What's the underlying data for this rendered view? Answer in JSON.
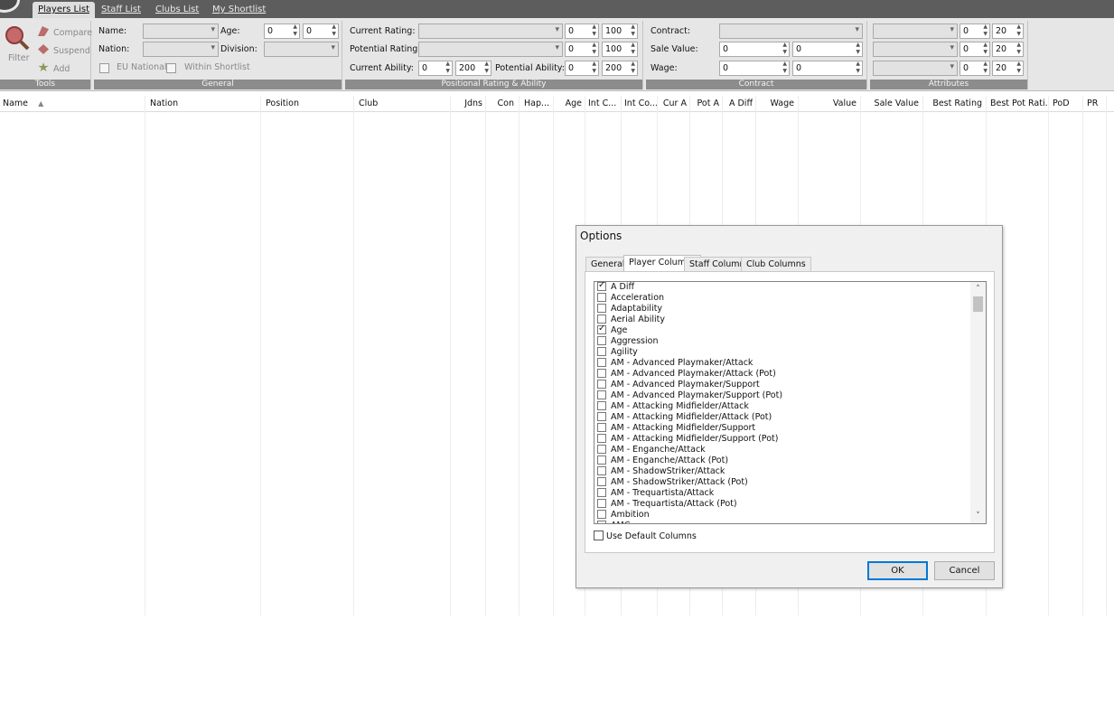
{
  "main_tabs": [
    {
      "label": "Players List"
    },
    {
      "label": "Staff List"
    },
    {
      "label": "Clubs List"
    },
    {
      "label": "My Shortlist"
    }
  ],
  "tools": {
    "filter": "Filter",
    "compare": "Compare",
    "suspend": "Suspend",
    "add": "Add",
    "title": "Tools"
  },
  "general": {
    "name_label": "Name:",
    "nation_label": "Nation:",
    "age_label": "Age:",
    "division_label": "Division:",
    "eu_national": "EU National",
    "within_shortlist": "Within Shortlist",
    "age_min": "0",
    "age_max": "0",
    "title": "General"
  },
  "rating": {
    "current_rating_label": "Current Rating:",
    "potential_rating_label": "Potential Rating:",
    "current_ability_label": "Current Ability:",
    "potential_ability_label": "Potential Ability:",
    "cr_min": "0",
    "cr_max": "100",
    "pr_min": "0",
    "pr_max": "100",
    "ca_min": "0",
    "ca_max": "200",
    "pa_min": "0",
    "pa_max": "200",
    "title": "Positional Rating & Ability"
  },
  "contract": {
    "contract_label": "Contract:",
    "sale_value_label": "Sale Value:",
    "wage_label": "Wage:",
    "sv_min": "0",
    "sv_max": "0",
    "wage_min": "0",
    "wage_max": "0",
    "title": "Contract"
  },
  "attributes": {
    "r1_min": "0",
    "r1_max": "20",
    "r2_min": "0",
    "r2_max": "20",
    "r3_min": "0",
    "r3_max": "20",
    "title": "Attributes"
  },
  "columns": [
    "Name",
    "Nation",
    "Position",
    "Club",
    "Jdns",
    "Con",
    "Hap...",
    "Age",
    "Int C...",
    "Int Co...",
    "Cur A",
    "Pot A",
    "A Diff",
    "Wage",
    "Value",
    "Sale Value",
    "Best Rating",
    "Best Pot Rati...",
    "PoD",
    "PR"
  ],
  "dialog": {
    "title": "Options",
    "tabs": [
      "General",
      "Player Columns",
      "Staff Columns",
      "Club Columns"
    ],
    "items": [
      {
        "label": "A Diff",
        "checked": true
      },
      {
        "label": "Acceleration",
        "checked": false
      },
      {
        "label": "Adaptability",
        "checked": false
      },
      {
        "label": "Aerial Ability",
        "checked": false
      },
      {
        "label": "Age",
        "checked": true
      },
      {
        "label": "Aggression",
        "checked": false
      },
      {
        "label": "Agility",
        "checked": false
      },
      {
        "label": "AM - Advanced Playmaker/Attack",
        "checked": false
      },
      {
        "label": "AM - Advanced Playmaker/Attack (Pot)",
        "checked": false
      },
      {
        "label": "AM - Advanced Playmaker/Support",
        "checked": false
      },
      {
        "label": "AM - Advanced Playmaker/Support (Pot)",
        "checked": false
      },
      {
        "label": "AM - Attacking Midfielder/Attack",
        "checked": false
      },
      {
        "label": "AM - Attacking Midfielder/Attack (Pot)",
        "checked": false
      },
      {
        "label": "AM - Attacking Midfielder/Support",
        "checked": false
      },
      {
        "label": "AM - Attacking Midfielder/Support (Pot)",
        "checked": false
      },
      {
        "label": "AM - Enganche/Attack",
        "checked": false
      },
      {
        "label": "AM - Enganche/Attack (Pot)",
        "checked": false
      },
      {
        "label": "AM - ShadowStriker/Attack",
        "checked": false
      },
      {
        "label": "AM - ShadowStriker/Attack (Pot)",
        "checked": false
      },
      {
        "label": "AM - Trequartista/Attack",
        "checked": false
      },
      {
        "label": "AM - Trequartista/Attack (Pot)",
        "checked": false
      },
      {
        "label": "Ambition",
        "checked": false
      },
      {
        "label": "AMC",
        "checked": false
      }
    ],
    "use_default_columns": "Use Default Columns",
    "ok": "OK",
    "cancel": "Cancel"
  }
}
